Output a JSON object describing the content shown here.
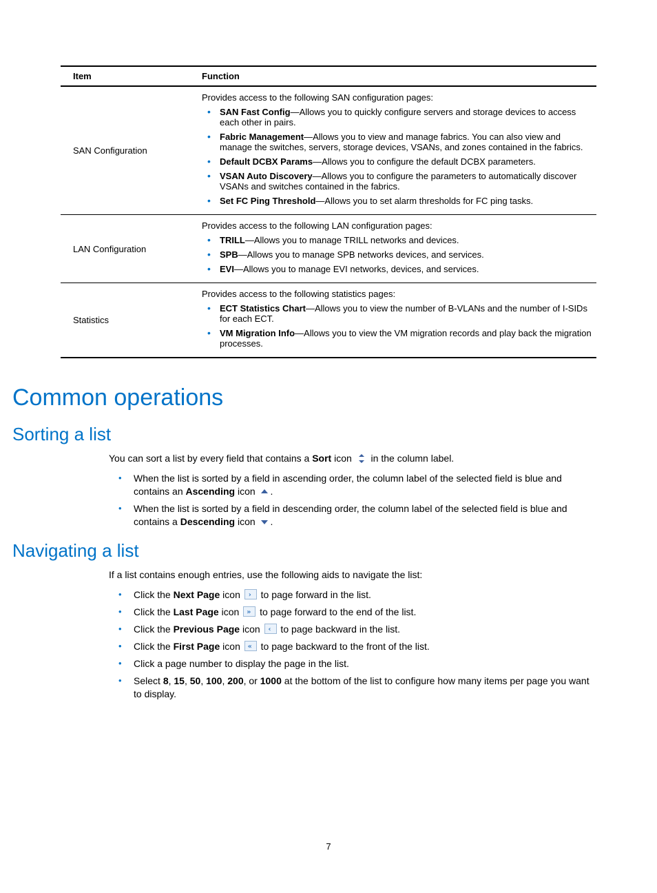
{
  "table": {
    "headers": {
      "item": "Item",
      "function": "Function"
    },
    "rows": [
      {
        "item": "SAN Configuration",
        "intro": "Provides access to the following SAN configuration pages:",
        "bullets": [
          {
            "label": "SAN Fast Config",
            "desc": "—Allows you to quickly configure servers and storage devices to access each other in pairs."
          },
          {
            "label": "Fabric Management",
            "desc": "—Allows you to view and manage fabrics. You can also view and manage the switches, servers, storage devices, VSANs, and zones contained in the fabrics."
          },
          {
            "label": "Default DCBX Params",
            "desc": "—Allows you to configure the default DCBX parameters."
          },
          {
            "label": "VSAN Auto Discovery",
            "desc": "—Allows you to configure the parameters to automatically discover VSANs and switches contained in the fabrics."
          },
          {
            "label": "Set FC Ping Threshold",
            "desc": "—Allows you to set alarm thresholds for FC ping tasks."
          }
        ]
      },
      {
        "item": "LAN Configuration",
        "intro": "Provides access to the following LAN configuration pages:",
        "bullets": [
          {
            "label": "TRILL",
            "desc": "—Allows you to manage TRILL networks and devices."
          },
          {
            "label": "SPB",
            "desc": "—Allows you to manage SPB networks devices, and services."
          },
          {
            "label": "EVI",
            "desc": "—Allows you to manage EVI networks, devices, and services."
          }
        ]
      },
      {
        "item": "Statistics",
        "intro": "Provides access to the following statistics pages:",
        "bullets": [
          {
            "label": "ECT Statistics Chart",
            "desc": "—Allows you to view the number of B-VLANs and the number of I-SIDs for each ECT."
          },
          {
            "label": "VM Migration Info",
            "desc": "—Allows you to view the VM migration records and play back the migration processes."
          }
        ]
      }
    ]
  },
  "h1": "Common operations",
  "sorting": {
    "heading": "Sorting a list",
    "intro_a": "You can sort a list by every field that contains a ",
    "intro_b": "Sort",
    "intro_c": " icon ",
    "intro_d": " in the column label.",
    "b1a": "When the list is sorted by a field in ascending order, the column label of the selected field is blue and contains an ",
    "b1b": "Ascending",
    "b1c": " icon ",
    "b1d": ".",
    "b2a": "When the list is sorted by a field in descending order, the column label of the selected field is blue and contains a ",
    "b2b": "Descending",
    "b2c": " icon ",
    "b2d": "."
  },
  "nav": {
    "heading": "Navigating a list",
    "intro": "If a list contains enough entries, use the following aids to navigate the list:",
    "b1a": "Click the ",
    "b1b": "Next Page",
    "b1c": " icon ",
    "b1d": " to page forward in the list.",
    "b2a": "Click the ",
    "b2b": "Last Page",
    "b2c": " icon ",
    "b2d": " to page forward to the end of the list.",
    "b3a": "Click the ",
    "b3b": "Previous Page",
    "b3c": " icon ",
    "b3d": " to page backward in the list.",
    "b4a": "Click the ",
    "b4b": "First Page",
    "b4c": " icon ",
    "b4d": " to page backward to the front of the list.",
    "b5": "Click a page number to display the page in the list.",
    "b6a": "Select ",
    "b6n1": "8",
    "b6s1": ", ",
    "b6n2": "15",
    "b6s2": ", ",
    "b6n3": "50",
    "b6s3": ", ",
    "b6n4": "100",
    "b6s4": ", ",
    "b6n5": "200",
    "b6s5": ", or ",
    "b6n6": "1000",
    "b6b": " at the bottom of the list to configure how many items per page you want to display."
  },
  "pageNumber": "7"
}
